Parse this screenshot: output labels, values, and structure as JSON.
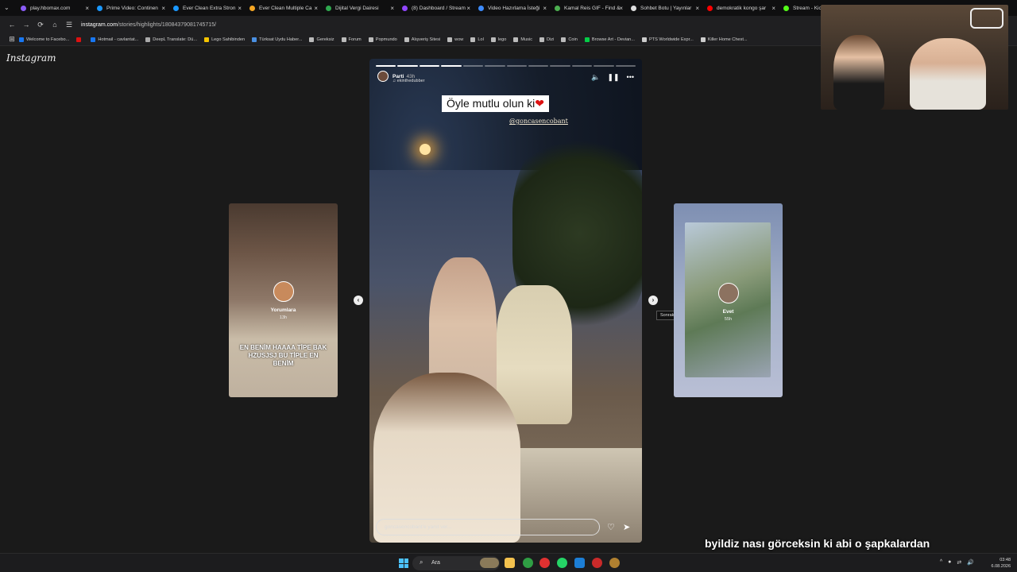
{
  "browser": {
    "tabs": [
      {
        "label": "play.hbomax.com",
        "color": "#8a5cf6"
      },
      {
        "label": "Prime Video: Continen",
        "color": "#1a98ff"
      },
      {
        "label": "Ever Clean Extra Stron",
        "color": "#1a98ff"
      },
      {
        "label": "Ever Clean Multiple Ca",
        "color": "#f5a623"
      },
      {
        "label": "Dijital Vergi Dairesi",
        "color": "#2fa84f"
      },
      {
        "label": "(8) Dashboard / Stream",
        "color": "#9146ff"
      },
      {
        "label": "Video Hazırlama İsteği",
        "color": "#3d8bfd"
      },
      {
        "label": "Kamal Reis GIF - Find &",
        "color": "#4caf50"
      },
      {
        "label": "Sohbet Botu | Yayınlar",
        "color": "#dddddd"
      },
      {
        "label": "demokratik kongo şar",
        "color": "#ff0000"
      },
      {
        "label": "Stream - Kick |",
        "color": "#53fc18"
      }
    ],
    "url_domain": "instagram.com",
    "url_path": "/stories/highlights/18084379081745715/",
    "bookmarks": [
      "Welcome to Facebo...",
      "",
      "Hotmail - cavlantat...",
      "DeepL Translate: Dü...",
      "Lego Sahibinden",
      "Türksat Uydu Haber...",
      "Gereksiz",
      "Forum",
      "Popmundo",
      "Alışveriş Sitesi",
      "wow",
      "Lol",
      "lego",
      "Music",
      "Dizi",
      "Coin",
      "Browse Art - Devian...",
      "PTS Worldwide Expr...",
      "Killer Home Chest..."
    ]
  },
  "instagram": {
    "logo": "Instagram",
    "left_card": {
      "name": "Yorumlara",
      "time": "13h",
      "caption": "EN BENİM HAAAA TİPE BAK HZUSJSJ BU TİPLE EN BENİM"
    },
    "right_card": {
      "name": "Evet",
      "time": "55h"
    },
    "story": {
      "user": "Parti",
      "time": "43h",
      "audio": "ekinthedubber",
      "caption": "Öyle mutlu olun ki",
      "heart": "❤",
      "mention": "@goncasencobant",
      "reply_placeholder": "goncasencobant'e yanıt ver...",
      "progress_total": 12,
      "progress_done": 4
    },
    "tooltip": "Sonraki"
  },
  "overlay": {
    "subtitle": "byildiz  nası görceksin ki abi o şapkalardan"
  },
  "taskbar": {
    "search": "Ara",
    "time": "03:48",
    "date": "6.08.2026"
  }
}
